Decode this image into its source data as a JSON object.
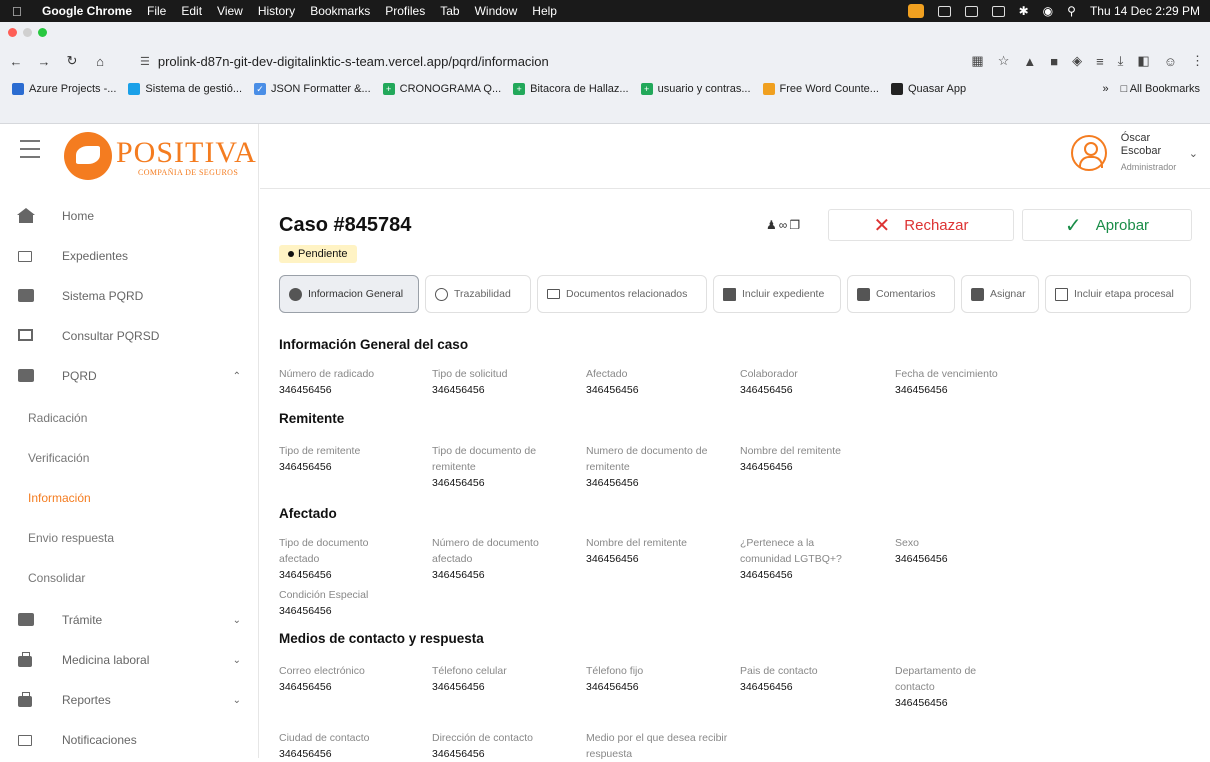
{
  "mac_menu": {
    "app": "Google Chrome",
    "items": [
      "File",
      "Edit",
      "View",
      "History",
      "Bookmarks",
      "Profiles",
      "Tab",
      "Window",
      "Help"
    ],
    "datetime": "Thu 14 Dec 2:29 PM"
  },
  "browser": {
    "url": "prolink-d87n-git-dev-digitalinktic-s-team.vercel.app/pqrd/informacion",
    "bookmarks": [
      "Azure Projects -...",
      "Sistema de gestió...",
      "JSON Formatter &...",
      "CRONOGRAMA Q...",
      "Bitacora de Hallaz...",
      "usuario y contras...",
      "Free Word Counte...",
      "Quasar App"
    ],
    "bookmark_colors": [
      "#2b6cd1",
      "#1aa0e8",
      "#4a8ee6",
      "#22a85a",
      "#22a85a",
      "#22a85a",
      "#f0a020",
      "#222222"
    ],
    "all_bookmarks": "All Bookmarks",
    "more": "»"
  },
  "logo": {
    "name": "POSITIVA",
    "tagline": "COMPAÑIA DE SEGUROS"
  },
  "sidebar": {
    "items": [
      {
        "label": "Home",
        "icon": "home-icon"
      },
      {
        "label": "Expedientes",
        "icon": "folder-icon"
      },
      {
        "label": "Sistema PQRD",
        "icon": "org-icon"
      },
      {
        "label": "Consultar PQRSD",
        "icon": "monitor-icon"
      },
      {
        "label": "PQRD",
        "icon": "id-card-icon"
      }
    ],
    "pqrd_sub": [
      "Radicación",
      "Verificación",
      "Información",
      "Envio respuesta",
      "Consolidar"
    ],
    "bottom": [
      {
        "label": "Trámite",
        "icon": "id-card-icon"
      },
      {
        "label": "Medicina laboral",
        "icon": "briefcase-icon"
      },
      {
        "label": "Reportes",
        "icon": "briefcase-icon"
      },
      {
        "label": "Notificaciones",
        "icon": "folder-icon"
      }
    ]
  },
  "user": {
    "first": "Óscar",
    "last": "Escobar",
    "role": "Administrador"
  },
  "case": {
    "title": "Caso #845784",
    "status": "Pendiente",
    "reject": "Rechazar",
    "approve": "Aprobar"
  },
  "tabs": [
    {
      "label": "Informacion General",
      "icon": "info-icon",
      "active": true
    },
    {
      "label": "Trazabilidad",
      "icon": "history-icon",
      "active": false
    },
    {
      "label": "Documentos relacionados",
      "icon": "folder-icon",
      "active": false
    },
    {
      "label": "Incluir expediente",
      "icon": "document-icon",
      "active": false
    },
    {
      "label": "Comentarios",
      "icon": "comments-icon",
      "active": false
    },
    {
      "label": "Asignar",
      "icon": "assign-icon",
      "active": false
    },
    {
      "label": "Incluir etapa procesal",
      "icon": "page-icon",
      "active": false
    }
  ],
  "sections": {
    "general": {
      "title": "Información General del caso",
      "fields": [
        {
          "k": "Número de radicado",
          "v": "346456456"
        },
        {
          "k": "Tipo de solicitud",
          "v": "346456456"
        },
        {
          "k": "Afectado",
          "v": "346456456"
        },
        {
          "k": "Colaborador",
          "v": "346456456"
        },
        {
          "k": "Fecha de vencimiento",
          "v": "346456456"
        }
      ]
    },
    "remitente": {
      "title": "Remitente",
      "fields": [
        {
          "k": "Tipo de remitente",
          "v": "346456456"
        },
        {
          "k": "Tipo de documento de remitente",
          "v": "346456456"
        },
        {
          "k": "Numero de documento de remitente",
          "v": "346456456"
        },
        {
          "k": "Nombre del remitente",
          "v": "346456456"
        }
      ]
    },
    "afectado": {
      "title": "Afectado",
      "fields": [
        {
          "k": "Tipo de documento afectado",
          "v": "346456456"
        },
        {
          "k": "Número de documento afectado",
          "v": "346456456"
        },
        {
          "k": "Nombre del remitente",
          "v": "346456456"
        },
        {
          "k": "¿Pertenece a la comunidad LGTBQ+?",
          "v": "346456456"
        },
        {
          "k": "Sexo",
          "v": "346456456"
        },
        {
          "k": "Condición Especial",
          "v": "346456456"
        }
      ]
    },
    "contacto": {
      "title": "Medios de contacto y respuesta",
      "fields": [
        {
          "k": "Correo electrónico",
          "v": "346456456"
        },
        {
          "k": "Télefono celular",
          "v": "346456456"
        },
        {
          "k": "Télefono fijo",
          "v": "346456456"
        },
        {
          "k": "Pais de contacto",
          "v": "346456456"
        },
        {
          "k": "Departamento de contacto",
          "v": "346456456"
        },
        {
          "k": "Ciudad de contacto",
          "v": "346456456"
        },
        {
          "k": "Dirección de contacto",
          "v": "346456456"
        },
        {
          "k": "Medio por el que desea recibir respuesta",
          "v": ""
        }
      ]
    }
  },
  "colors": {
    "brand": "#f47c20",
    "reject": "#dd3333",
    "approve": "#1a8d48",
    "badge": "#fff3c4"
  }
}
